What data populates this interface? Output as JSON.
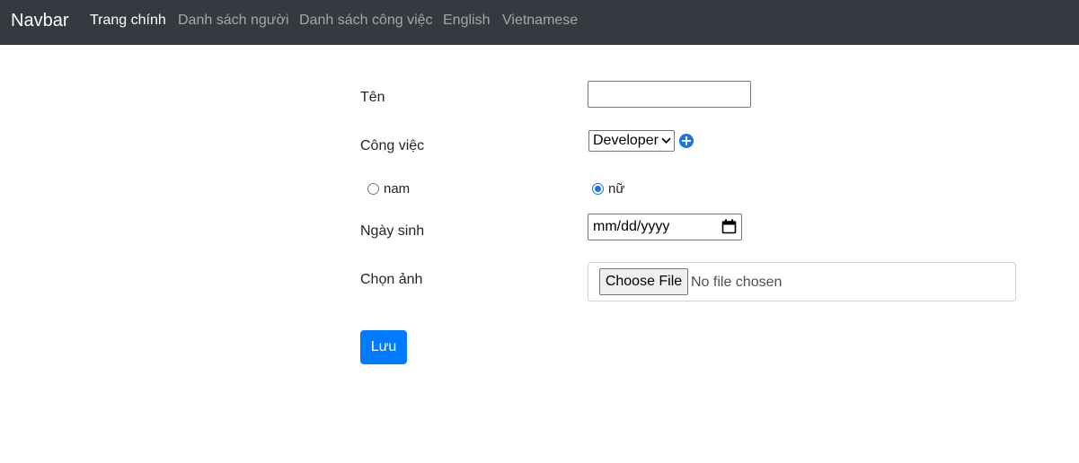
{
  "navbar": {
    "brand": "Navbar",
    "links": [
      {
        "label": "Trang chính"
      },
      {
        "label": "Danh sách người"
      },
      {
        "label": "Danh sách công việc"
      },
      {
        "label": "English"
      },
      {
        "label": "Vietnamese"
      }
    ]
  },
  "form": {
    "name_label": "Tên",
    "name_value": "",
    "job_label": "Công việc",
    "job_selected": "Developer",
    "gender_options": [
      {
        "label": "nam",
        "checked": false
      },
      {
        "label": "nữ",
        "checked": true
      }
    ],
    "birthday_label": "Ngày sinh",
    "birthday_placeholder": "mm/dd/yyyy",
    "photo_label": "Chọn ảnh",
    "file_button_label": "Choose File",
    "file_status": "No file chosen",
    "save_label": "Lưu"
  },
  "colors": {
    "navbar_bg": "#343a40",
    "primary": "#007bff",
    "radio_accent": "#1a73e8"
  },
  "icons": [
    "add-circle-icon",
    "calendar-icon",
    "chevron-down-icon"
  ]
}
